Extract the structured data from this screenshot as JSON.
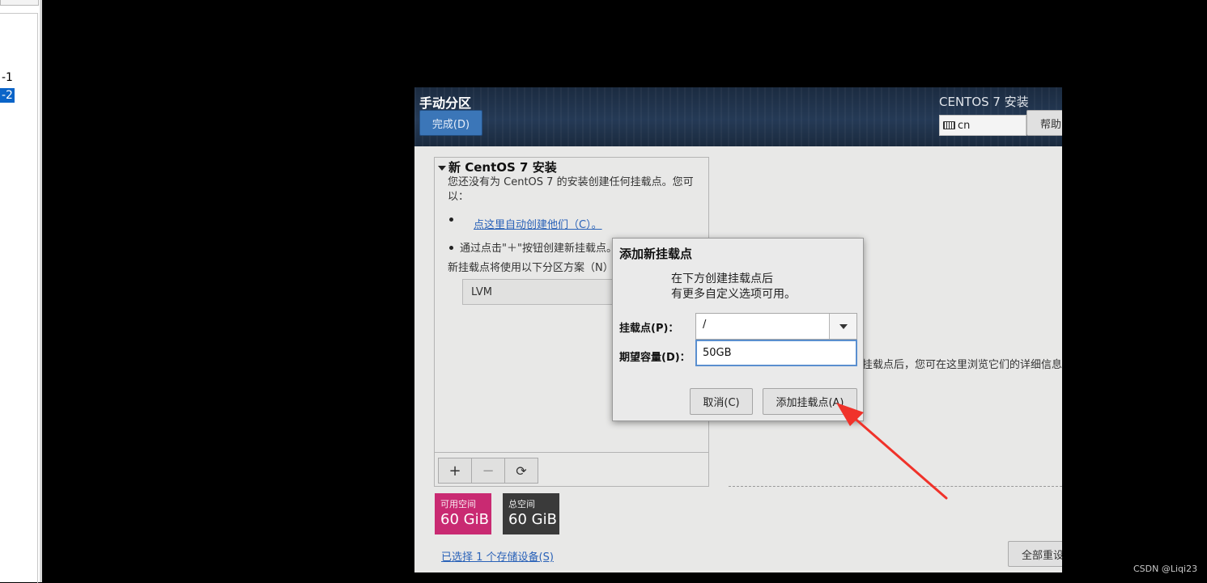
{
  "host": {
    "tree_items": [
      "-1",
      "-2"
    ]
  },
  "header": {
    "title": "手动分区",
    "done_button": "完成(D)",
    "product": "CENTOS 7 安装",
    "keyboard_layout": "cn",
    "help_button": "帮助"
  },
  "left_panel": {
    "tree_title": "新 CentOS 7 安装",
    "intro_line1": "您还没有为 CentOS 7 的安装创建任何挂载点。您可",
    "intro_line2": "以：",
    "auto_link": "点这里自动创建他们（C）。",
    "manual_hint": "通过点击\"＋\"按钮创建新挂载点。",
    "scheme_label": "新挂载点将使用以下分区方案（N）",
    "scheme_value": "LVM",
    "toolbar": {
      "add": "+",
      "remove": "−",
      "refresh": "⟳"
    }
  },
  "capacity": {
    "available_label": "可用空间",
    "available_value": "60 GiB",
    "total_label": "总空间",
    "total_value": "60 GiB"
  },
  "storage_link": "已选择 1 个存储设备(S)",
  "reset_button": "全部重设",
  "right_info": "挂载点后，您可在这里浏览它们的详细信息。",
  "dialog": {
    "title": "添加新挂载点",
    "desc_line1": "在下方创建挂载点后",
    "desc_line2": "有更多自定义选项可用。",
    "mount_label": "挂载点(P)：",
    "mount_value": "/",
    "capacity_label": "期望容量(D)：",
    "capacity_value": "50GB",
    "cancel_button": "取消(C)",
    "add_button": "添加挂载点(A)"
  },
  "annotation": {
    "arrow_color": "#f0322a"
  },
  "watermark": "CSDN @Liqi23"
}
